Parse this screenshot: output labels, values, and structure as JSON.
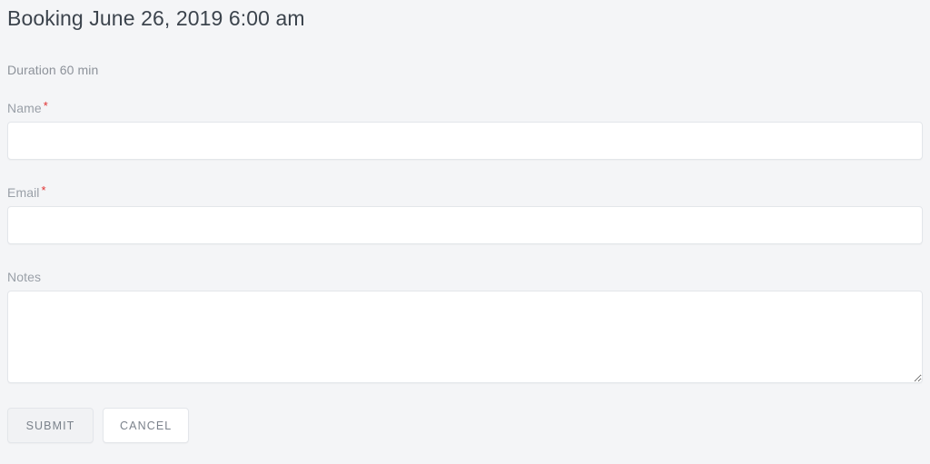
{
  "header": {
    "title": "Booking June 26, 2019 6:00 am",
    "duration": "Duration 60 min"
  },
  "form": {
    "fields": [
      {
        "label": "Name",
        "required": true,
        "required_mark": "*",
        "value": "",
        "placeholder": ""
      },
      {
        "label": "Email",
        "required": true,
        "required_mark": "*",
        "value": "",
        "placeholder": ""
      },
      {
        "label": "Notes",
        "required": false,
        "required_mark": "",
        "value": "",
        "placeholder": ""
      }
    ]
  },
  "actions": {
    "submit_label": "SUBMIT",
    "cancel_label": "CANCEL"
  },
  "colors": {
    "background": "#f4f5f7",
    "title_text": "#3c444d",
    "muted_text": "#8d929a",
    "label_text": "#9aa0a8",
    "required_asterisk": "#e03131",
    "input_background": "#ffffff",
    "input_border": "#e3e6ea",
    "button_text": "#7b828b",
    "submit_background": "#f1f2f4",
    "cancel_background": "#ffffff"
  }
}
